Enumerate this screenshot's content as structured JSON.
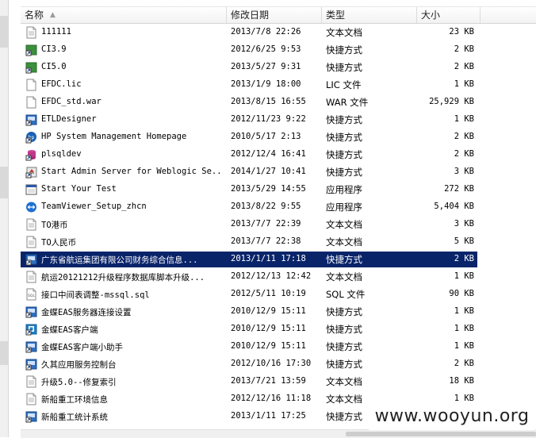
{
  "columns": {
    "name": "名称",
    "date": "修改日期",
    "type": "类型",
    "size": "大小"
  },
  "files": [
    {
      "name": "111111",
      "date": "2013/7/8 22:26",
      "type": "文本文档",
      "size": "23 KB",
      "icon": "text-file-icon"
    },
    {
      "name": "CI3.9",
      "date": "2012/6/25 9:53",
      "type": "快捷方式",
      "size": "2 KB",
      "icon": "shortcut-icon"
    },
    {
      "name": "CI5.0",
      "date": "2013/5/27 9:31",
      "type": "快捷方式",
      "size": "2 KB",
      "icon": "shortcut-icon"
    },
    {
      "name": "EFDC.lic",
      "date": "2013/1/9 18:00",
      "type": "LIC 文件",
      "size": "1 KB",
      "icon": "blank-file-icon"
    },
    {
      "name": "EFDC_std.war",
      "date": "2013/8/15 16:55",
      "type": "WAR 文件",
      "size": "25,929 KB",
      "icon": "blank-file-icon"
    },
    {
      "name": "ETLDesigner",
      "date": "2012/11/23 9:22",
      "type": "快捷方式",
      "size": "1 KB",
      "icon": "app-shortcut-icon"
    },
    {
      "name": "HP System Management Homepage",
      "date": "2010/5/17 2:13",
      "type": "快捷方式",
      "size": "2 KB",
      "icon": "hp-shortcut-icon"
    },
    {
      "name": "plsqldev",
      "date": "2012/12/4 16:41",
      "type": "快捷方式",
      "size": "2 KB",
      "icon": "database-shortcut-icon"
    },
    {
      "name": "Start Admin Server for Weblogic Se...",
      "date": "2014/1/27 10:41",
      "type": "快捷方式",
      "size": "3 KB",
      "icon": "server-shortcut-icon"
    },
    {
      "name": "Start Your Test",
      "date": "2013/5/29 14:55",
      "type": "应用程序",
      "size": "272 KB",
      "icon": "application-icon"
    },
    {
      "name": "TeamViewer_Setup_zhcn",
      "date": "2013/8/22 9:55",
      "type": "应用程序",
      "size": "5,404 KB",
      "icon": "teamviewer-icon"
    },
    {
      "name": "TO港币",
      "date": "2013/7/7 22:39",
      "type": "文本文档",
      "size": "3 KB",
      "icon": "text-file-icon"
    },
    {
      "name": "TO人民币",
      "date": "2013/7/7 22:38",
      "type": "文本文档",
      "size": "5 KB",
      "icon": "text-file-icon"
    },
    {
      "name": "广东省航运集团有限公司财务综合信息...",
      "date": "2013/1/11 17:18",
      "type": "快捷方式",
      "size": "2 KB",
      "icon": "app-shortcut-icon",
      "selected": true
    },
    {
      "name": "航运20121212升级程序数据库脚本升级...",
      "date": "2012/12/13 12:42",
      "type": "文本文档",
      "size": "1 KB",
      "icon": "text-file-icon"
    },
    {
      "name": "接口中间表调整-mssql.sql",
      "date": "2012/5/11 10:19",
      "type": "SQL 文件",
      "size": "90 KB",
      "icon": "sql-file-icon"
    },
    {
      "name": "金蝶EAS服务器连接设置",
      "date": "2010/12/9 15:11",
      "type": "快捷方式",
      "size": "1 KB",
      "icon": "app-shortcut-icon"
    },
    {
      "name": "金蝶EAS客户端",
      "date": "2010/12/9 15:11",
      "type": "快捷方式",
      "size": "1 KB",
      "icon": "eas-shortcut-icon"
    },
    {
      "name": "金蝶EAS客户端小助手",
      "date": "2010/12/9 15:11",
      "type": "快捷方式",
      "size": "1 KB",
      "icon": "app-shortcut-icon"
    },
    {
      "name": "久其应用服务控制台",
      "date": "2012/10/16 17:30",
      "type": "快捷方式",
      "size": "2 KB",
      "icon": "app-shortcut-icon"
    },
    {
      "name": "升级5.0--修复索引",
      "date": "2013/7/21 13:59",
      "type": "文本文档",
      "size": "18 KB",
      "icon": "text-file-icon"
    },
    {
      "name": "新船重工环境信息",
      "date": "2012/12/16 11:18",
      "type": "文本文档",
      "size": "1 KB",
      "icon": "text-file-icon"
    },
    {
      "name": "新船重工统计系统",
      "date": "2013/1/11 17:25",
      "type": "快捷方式",
      "size": "",
      "icon": "app-shortcut-icon"
    }
  ],
  "watermark": "www.wooyun.org",
  "colors": {
    "selection": "#0a246a",
    "header_bg": "#f4f4f4"
  }
}
